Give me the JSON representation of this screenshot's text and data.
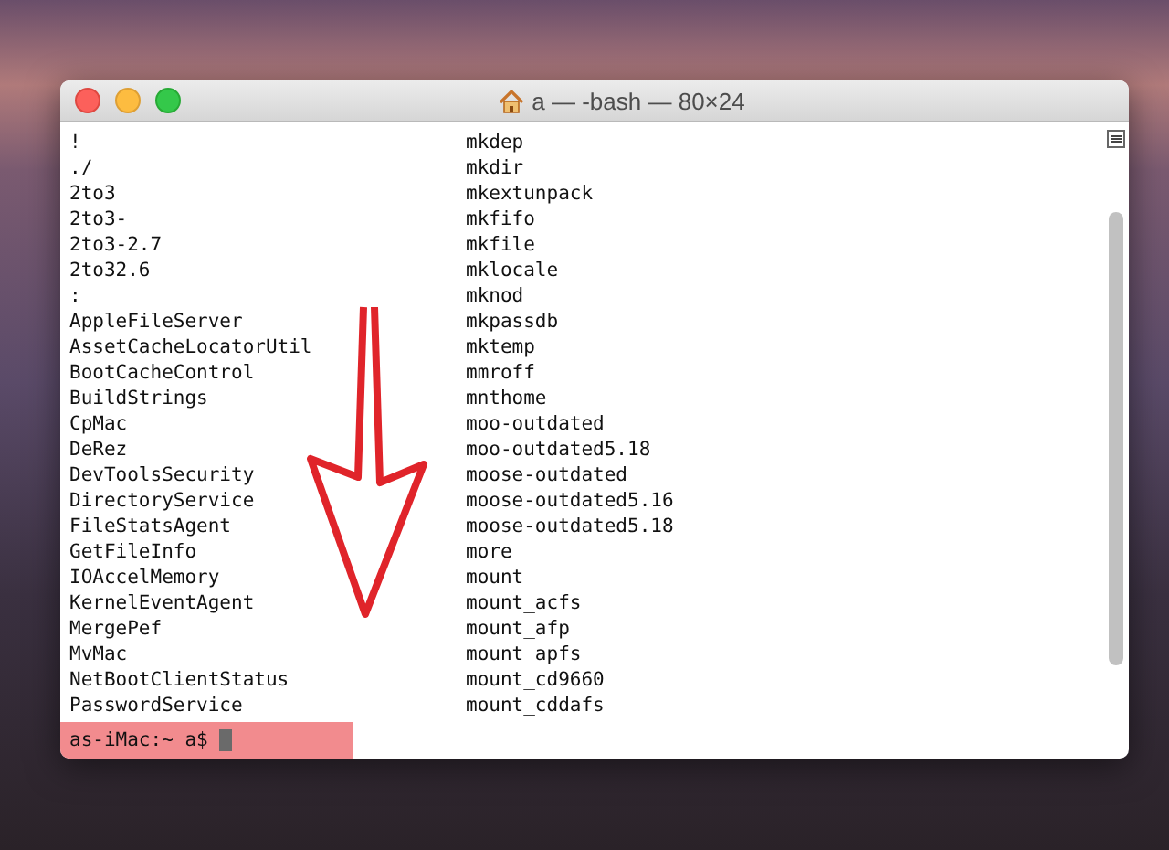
{
  "window": {
    "title": "a — -bash — 80×24"
  },
  "rows": [
    {
      "left": "!",
      "right": "mkdep"
    },
    {
      "left": "./",
      "right": "mkdir"
    },
    {
      "left": "2to3",
      "right": "mkextunpack"
    },
    {
      "left": "2to3-",
      "right": "mkfifo"
    },
    {
      "left": "2to3-2.7",
      "right": "mkfile"
    },
    {
      "left": "2to32.6",
      "right": "mklocale"
    },
    {
      "left": ":",
      "right": "mknod"
    },
    {
      "left": "AppleFileServer",
      "right": "mkpassdb"
    },
    {
      "left": "AssetCacheLocatorUtil",
      "right": "mktemp"
    },
    {
      "left": "BootCacheControl",
      "right": "mmroff"
    },
    {
      "left": "BuildStrings",
      "right": "mnthome"
    },
    {
      "left": "CpMac",
      "right": "moo-outdated"
    },
    {
      "left": "DeRez",
      "right": "moo-outdated5.18"
    },
    {
      "left": "DevToolsSecurity",
      "right": "moose-outdated"
    },
    {
      "left": "DirectoryService",
      "right": "moose-outdated5.16"
    },
    {
      "left": "FileStatsAgent",
      "right": "moose-outdated5.18"
    },
    {
      "left": "GetFileInfo",
      "right": "more"
    },
    {
      "left": "IOAccelMemory",
      "right": "mount"
    },
    {
      "left": "KernelEventAgent",
      "right": "mount_acfs"
    },
    {
      "left": "MergePef",
      "right": "mount_afp"
    },
    {
      "left": "MvMac",
      "right": "mount_apfs"
    },
    {
      "left": "NetBootClientStatus",
      "right": "mount_cd9660"
    },
    {
      "left": "PasswordService",
      "right": "mount_cddafs"
    }
  ],
  "prompt": {
    "text": "as-iMac:~ a$",
    "highlighted": true
  }
}
